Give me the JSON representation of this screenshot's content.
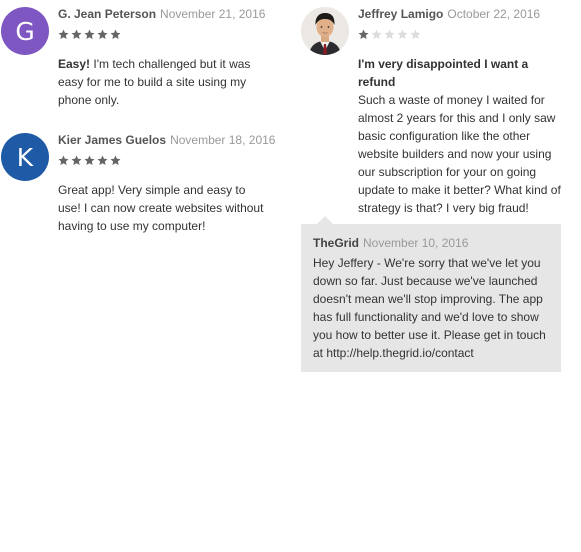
{
  "reviews": [
    {
      "avatar_letter": "G",
      "avatar_color": "#7e57c2",
      "name": "G. Jean Peterson",
      "date": "November 21, 2016",
      "rating": 5,
      "bold_text": "Easy!",
      "text": " I'm tech challenged but it was easy for me to build a site using my phone only."
    },
    {
      "avatar_letter": "K",
      "avatar_color": "#1f5aa6",
      "name": "Kier James Guelos",
      "date": "November 18, 2016",
      "rating": 5,
      "bold_text": "",
      "text": "Great app! Very simple and easy to use! I can now create websites without having to use my computer!"
    },
    {
      "avatar_icon": "profile-photo",
      "name": "Jeffrey Lamigo",
      "date": "October 22, 2016",
      "rating": 1,
      "bold_text": "I'm very disappointed I want a refund",
      "text": "Such a waste of money I waited for almost 2 years for this and I only saw basic configuration like the other website builders and now your using our subscription for your on going update to make it better? What kind of strategy is that? I very big fraud!"
    }
  ],
  "reply": {
    "name": "TheGrid",
    "date": "November 10, 2016",
    "text": "Hey Jeffery - We're sorry that we've let you down so far. Just because we've launched doesn't mean we'll stop improving. The app has full functionality and we'd love to show you how to better use it. Please get in touch at http://help.thegrid.io/contact"
  },
  "colors": {
    "star_filled": "#666666",
    "star_empty": "#dddddd"
  }
}
